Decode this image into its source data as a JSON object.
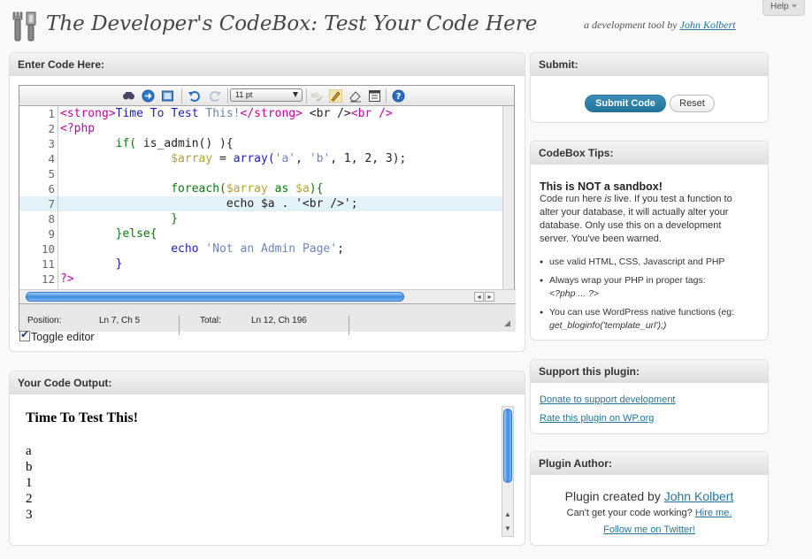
{
  "help": {
    "label": "Help"
  },
  "header": {
    "title": "The Developer's CodeBox: Test Your Code Here",
    "tagline_prefix": "a development tool by",
    "author_link": "John Kolbert"
  },
  "code_panel": {
    "title": "Enter Code Here:",
    "toolbar": {
      "font_size": "11 pt"
    },
    "lines": [
      {
        "n": "1"
      },
      {
        "n": "2"
      },
      {
        "n": "3"
      },
      {
        "n": "4"
      },
      {
        "n": "5"
      },
      {
        "n": "6"
      },
      {
        "n": "7"
      },
      {
        "n": "8"
      },
      {
        "n": "9"
      },
      {
        "n": "10"
      },
      {
        "n": "11"
      },
      {
        "n": "12"
      }
    ],
    "code": {
      "l1a": "<strong>",
      "l1b": "Time To Test ",
      "l1c": "This!",
      "l1d": "</strong>",
      "l1e": " <br />",
      "l1f": "<br />",
      "l2": "<?php",
      "l3a": "        if( ",
      "l3b": "is_admin() ){",
      "l4a": "                ",
      "l4b": "$array",
      "l4c": " = ",
      "l4d": "array(",
      "l4e": "'a'",
      "l4f": ", ",
      "l4g": "'b'",
      "l4h": ", 1, 2, 3);",
      "l6a": "                ",
      "l6b": "foreach(",
      "l6c": "$array",
      "l6d": " as ",
      "l6e": "$a",
      "l6f": "){",
      "l7": "                        echo $a . '<br />';",
      "l8": "                }",
      "l9a": "        ",
      "l9b": "}else{",
      "l10a": "                ",
      "l10b": "echo",
      "l10c": " ",
      "l10d": "'Not an Admin Page'",
      "l10e": ";",
      "l11": "        }",
      "l12": "?>"
    },
    "status": {
      "position_label": "Position:",
      "position_value": "Ln 7, Ch 5",
      "total_label": "Total:",
      "total_value": "Ln 12, Ch 196"
    },
    "toggle_label": "Toggle editor"
  },
  "output_panel": {
    "title": "Your Code Output:",
    "strong": "Time To Test This!",
    "lines": [
      "a",
      "b",
      "1",
      "2",
      "3"
    ]
  },
  "submit_panel": {
    "title": "Submit:",
    "submit_label": "Submit Code",
    "reset_label": "Reset"
  },
  "tips_panel": {
    "title": "CodeBox Tips:",
    "heading": "This is NOT a sandbox!",
    "p1": "Code run here ",
    "p1_em": "is",
    "p1_rest": " live. If you test a function to",
    "p2": "alter your database, it will actually alter your",
    "p3": "database. Only use this on a development",
    "p4": "server. You've been warned.",
    "b1": "use valid HTML, CSS, Javascript and PHP",
    "b2a": "Always wrap your PHP in proper tags:",
    "b2b": "<?php ... ?>",
    "b3a": "You can use WordPress native functions (eg:",
    "b3b": "get_bloginfo('template_url');)"
  },
  "support_panel": {
    "title": "Support this plugin:",
    "donate": "Donate to support development",
    "rate": "Rate this plugin on WP.org"
  },
  "author_panel": {
    "title": "Plugin Author:",
    "created_prefix": "Plugin created by",
    "author_name": "John Kolbert",
    "help_prefix": "Can't get your code working?",
    "hire": "Hire me.",
    "twitter": "Follow me on Twitter!"
  },
  "colors": {
    "link": "#21759b",
    "button_primary": "#21759b",
    "html_tag": "#c300a5",
    "keyword": "#0a7a0a",
    "variable": "#b4a23a",
    "string": "#6b86b4",
    "function": "#1d1dbd",
    "current_line": "#e3f1f8"
  },
  "icons": [
    "logo-tools-icon",
    "search-icon",
    "goto-icon",
    "fullscreen-icon",
    "undo-icon",
    "redo-icon",
    "spellcheck-icon",
    "highlight-icon",
    "reset-highlight-icon",
    "syntax-icon",
    "help-icon"
  ]
}
